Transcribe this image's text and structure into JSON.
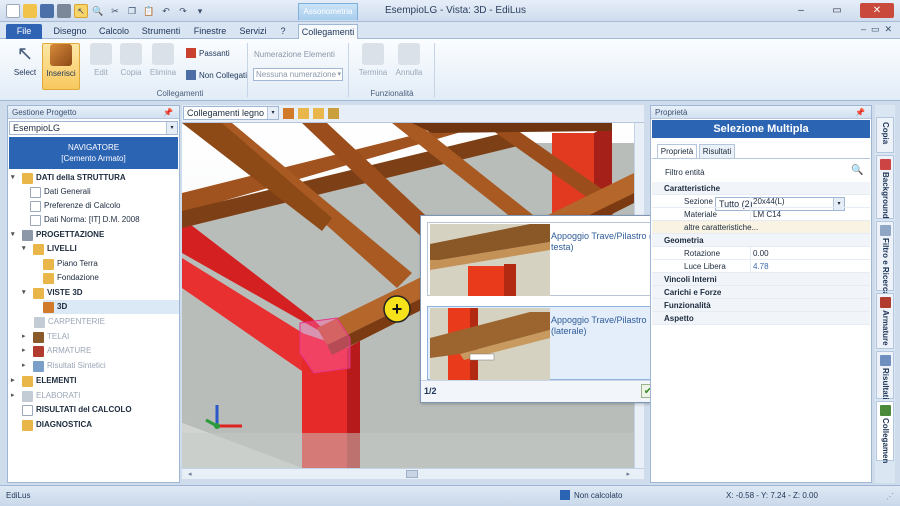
{
  "title": {
    "context_tab": "Assonometria",
    "window_title": "EsempioLG  -  Vista: 3D - EdiLus"
  },
  "tabs": [
    "File",
    "Disegno",
    "Calcolo",
    "Strumenti",
    "Finestre",
    "Servizi",
    "?",
    "Collegamenti"
  ],
  "ribbon": {
    "buttons": {
      "select": "Select",
      "insert": "Inserisci",
      "edit": "Edit",
      "copy": "Copia",
      "delete": "Elimina",
      "end": "Termina",
      "cancel": "Annulla"
    },
    "passanti": "Passanti",
    "non_collegati": "Non Collegati",
    "numbering_label": "Numerazione Elementi",
    "numbering_value": "Nessuna numerazione",
    "group_collegamenti": "Collegamenti",
    "group_funzionalita": "Funzionalità"
  },
  "left_panel": {
    "header": "Gestione Progetto",
    "project": "EsempioLG",
    "nav_title": "NAVIGATORE",
    "nav_subtitle": "[Cemento Armato]",
    "tree": [
      {
        "label": "DATI della STRUTTURA",
        "exp": "▾"
      },
      {
        "label": "Dati Generali",
        "exp": ""
      },
      {
        "label": "Preferenze di Calcolo",
        "exp": ""
      },
      {
        "label": "Dati Norma: [IT] D.M. 2008",
        "exp": ""
      },
      {
        "label": "PROGETTAZIONE",
        "exp": "▾"
      },
      {
        "label": "LIVELLI",
        "exp": "▾"
      },
      {
        "label": "Piano Terra",
        "exp": ""
      },
      {
        "label": "Fondazione",
        "exp": ""
      },
      {
        "label": "VISTE 3D",
        "exp": "▾"
      },
      {
        "label": "3D",
        "exp": ""
      },
      {
        "label": "CARPENTERIE",
        "exp": ""
      },
      {
        "label": "TELAI",
        "exp": "▸"
      },
      {
        "label": "ARMATURE",
        "exp": "▸"
      },
      {
        "label": "Risultati Sintetici",
        "exp": "▸"
      },
      {
        "label": "ELEMENTI",
        "exp": "▸"
      },
      {
        "label": "ELABORATI",
        "exp": "▸"
      },
      {
        "label": "RISULTATI del CALCOLO",
        "exp": ""
      },
      {
        "label": "DIAGNOSTICA",
        "exp": ""
      }
    ]
  },
  "viewport": {
    "combo": "Collegamenti legno"
  },
  "popup": {
    "option1": "Appoggio Trave/Pilastro (in testa)",
    "option2": "Appoggio Trave/Pilastro (laterale)",
    "page": "1/2",
    "ok": "✔",
    "cancel": "✖"
  },
  "right_panel": {
    "header": "Proprietà",
    "title": "Selezione Multipla",
    "tab_props": "Proprietà",
    "tab_results": "Risultati",
    "filter_label": "Filtro entità",
    "filter_value": "Tutto (2)",
    "rows": [
      {
        "k": "Caratteristiche",
        "v": "",
        "cat": true
      },
      {
        "k": "Sezione",
        "v": "20x44(L)",
        "cat": false
      },
      {
        "k": "Materiale",
        "v": "LM C14",
        "cat": false
      },
      {
        "k": "altre caratteristiche...",
        "v": "",
        "cat": false
      },
      {
        "k": "Geometria",
        "v": "",
        "cat": true
      },
      {
        "k": "Rotazione",
        "v": "0.00",
        "cat": false
      },
      {
        "k": "Luce Libera",
        "v": "4.78",
        "cat": false
      },
      {
        "k": "Vincoli Interni",
        "v": "",
        "cat": true
      },
      {
        "k": "Carichi e Forze",
        "v": "",
        "cat": true
      },
      {
        "k": "Funzionalità",
        "v": "",
        "cat": true
      },
      {
        "k": "Aspetto",
        "v": "",
        "cat": true
      }
    ]
  },
  "side_tabs": [
    "Copia",
    "Background",
    "Filtro e Ricerca",
    "Armature",
    "Risultati",
    "Collegamen"
  ],
  "status": {
    "app": "EdiLus",
    "calc": "Non calcolato",
    "coords": "X: -0.58 - Y: 7.24 - Z: 0.00"
  },
  "colors": {
    "accent": "#2c64b4",
    "column": "#e22a2a",
    "beam": "#a0521f"
  }
}
